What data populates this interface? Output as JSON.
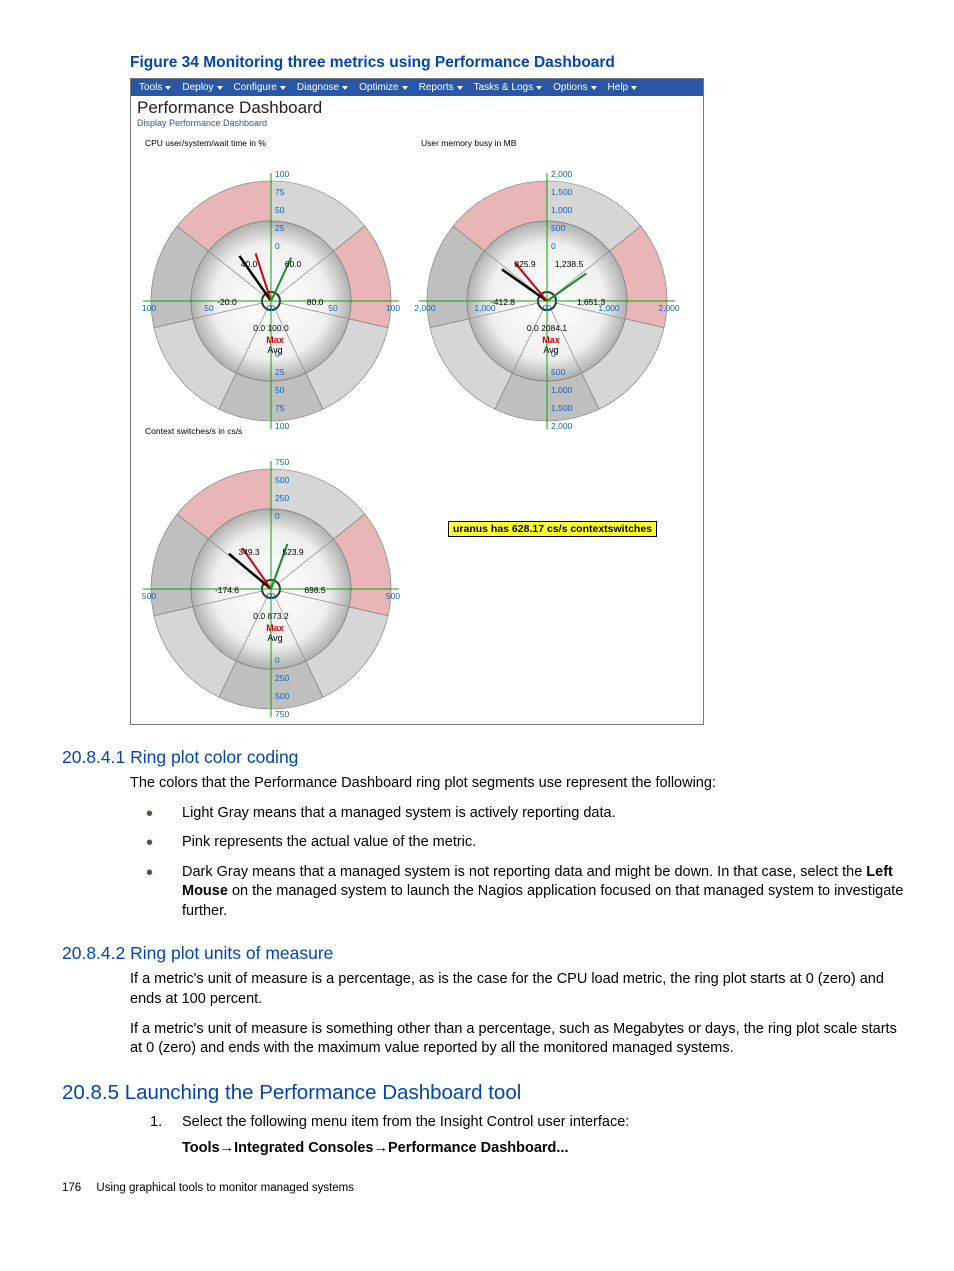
{
  "figure": {
    "caption": "Figure 34 Monitoring three metrics using Performance Dashboard",
    "menubar": [
      "Tools",
      "Deploy",
      "Configure",
      "Diagnose",
      "Optimize",
      "Reports",
      "Tasks & Logs",
      "Options",
      "Help"
    ],
    "title": "Performance Dashboard",
    "subtitle": "Display Performance Dashboard",
    "gauges": [
      {
        "label": "CPU user/system/wait time  in %",
        "top_ticks": [
          "100",
          "75",
          "50",
          "25",
          "0"
        ],
        "left_ticks": [
          "100",
          "50",
          "0"
        ],
        "right_ticks": [
          "0",
          "50",
          "100"
        ],
        "bottom_ticks": [
          "0",
          "25",
          "50",
          "75",
          "100"
        ],
        "inner_top": [
          "40.0",
          "60.0"
        ],
        "inner_mid": [
          "-20.0",
          "80.0"
        ],
        "inner_bot": "0.0 100.0",
        "max_avg": "Max\nAvg",
        "pointer_deg": -35,
        "red_deg": -18,
        "green_deg": 25,
        "tooltip": ""
      },
      {
        "label": "User memory busy in MB",
        "top_ticks": [
          "2,000",
          "1,500",
          "1,000",
          "500",
          "0"
        ],
        "left_ticks": [
          "2,000",
          "1,000",
          "0"
        ],
        "right_ticks": [
          "0",
          "1,000",
          "2,000"
        ],
        "bottom_ticks": [
          "0",
          "500",
          "1,000",
          "1,500",
          "2,000"
        ],
        "inner_top": [
          "825.9",
          "1,238.5"
        ],
        "inner_mid": [
          "-412.8",
          "1,651.3"
        ],
        "inner_bot": "0.0 2084.1",
        "max_avg": "Max\nAvg",
        "pointer_deg": -55,
        "red_deg": -40,
        "green_deg": 55,
        "tooltip": ""
      },
      {
        "label": "Context switches/s in cs/s",
        "top_ticks": [
          "750",
          "500",
          "250",
          "0"
        ],
        "left_ticks": [
          "500",
          "0"
        ],
        "right_ticks": [
          "0",
          "500"
        ],
        "bottom_ticks": [
          "0",
          "250",
          "500",
          "750"
        ],
        "inner_top": [
          "349.3",
          "523.9"
        ],
        "inner_mid": [
          "-174.6",
          "698.5"
        ],
        "inner_bot": "0.0 873.2",
        "max_avg": "Max\nAvg",
        "pointer_deg": -50,
        "red_deg": -35,
        "green_deg": 20,
        "tooltip": "uranus has 628.17 cs/s contextswitches"
      }
    ]
  },
  "section_a": {
    "heading": "20.8.4.1 Ring plot color coding",
    "intro": "The colors that the Performance Dashboard ring plot segments use represent the following:",
    "bullets": [
      "Light Gray means that a managed system is actively reporting data.",
      "Pink represents the actual value of the metric.",
      {
        "pre": "Dark Gray means that a managed system is not reporting data and might be down. In that case, select the ",
        "bold": "Left Mouse",
        "post": " on the managed system to launch the Nagios application focused on that managed system to investigate further."
      }
    ]
  },
  "section_b": {
    "heading": "20.8.4.2 Ring plot units of measure",
    "p1": "If a metric's unit of measure is a percentage, as is the case for the CPU load metric, the ring plot starts at 0 (zero) and ends at 100 percent.",
    "p2": "If a metric's unit of measure is something other than a percentage, such as Megabytes or days, the ring plot scale starts at 0 (zero) and ends with the maximum value reported by all the monitored managed systems."
  },
  "section_c": {
    "heading": "20.8.5 Launching the Performance Dashboard tool",
    "step1": "Select the following menu item from the Insight Control user interface:",
    "path": "Tools→Integrated Consoles→Performance Dashboard..."
  },
  "footer": {
    "page": "176",
    "title": "Using graphical tools to monitor managed systems"
  },
  "chart_data": [
    {
      "type": "gauge",
      "title": "CPU user/system/wait time in %",
      "unit": "%",
      "scale_min": 0,
      "scale_max": 100,
      "inner_labels": {
        "ticks": [
          -20.0,
          40.0,
          60.0,
          80.0
        ],
        "min": 0.0,
        "max": 100.0
      },
      "annotations": [
        "Max",
        "Avg"
      ]
    },
    {
      "type": "gauge",
      "title": "User memory busy in MB",
      "unit": "MB",
      "scale_min": 0,
      "scale_max": 2000,
      "inner_labels": {
        "ticks": [
          -412.8,
          825.9,
          1238.5,
          1651.3
        ],
        "min": 0.0,
        "max": 2084.1
      },
      "annotations": [
        "Max",
        "Avg"
      ]
    },
    {
      "type": "gauge",
      "title": "Context switches/s in cs/s",
      "unit": "cs/s",
      "scale_min": 0,
      "scale_max": 750,
      "inner_labels": {
        "ticks": [
          -174.6,
          349.3,
          523.9,
          698.5
        ],
        "min": 0.0,
        "max": 873.2
      },
      "tooltip": "uranus has 628.17 cs/s contextswitches",
      "annotations": [
        "Max",
        "Avg"
      ]
    }
  ]
}
